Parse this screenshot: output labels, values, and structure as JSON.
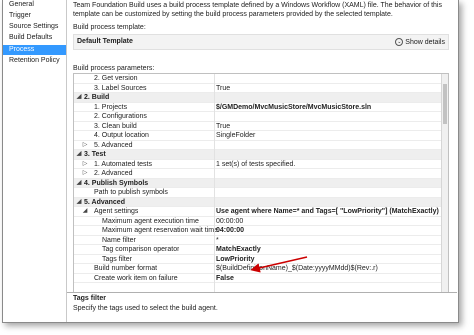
{
  "nav": {
    "items": [
      {
        "label": "General"
      },
      {
        "label": "Trigger"
      },
      {
        "label": "Source Settings"
      },
      {
        "label": "Build Defaults"
      },
      {
        "label": "Process"
      },
      {
        "label": "Retention Policy"
      }
    ],
    "selected_index": 4
  },
  "description": "Team Foundation Build uses a build process template defined by a Windows Workflow (XAML) file. The behavior of this template can be customized by setting the build process parameters provided by the selected template.",
  "template": {
    "label": "Build process template:",
    "name": "Default Template",
    "show_details": "Show details"
  },
  "params_label": "Build process parameters:",
  "rows": [
    {
      "name": "2. Get version",
      "value": "",
      "indent": 1,
      "header": false,
      "expander": "",
      "bold_value": false
    },
    {
      "name": "3. Label Sources",
      "value": "True",
      "indent": 1,
      "header": false,
      "expander": "",
      "bold_value": false
    },
    {
      "name": "2. Build",
      "value": "",
      "indent": 0,
      "header": true,
      "expander": "◢",
      "bold_value": false
    },
    {
      "name": "1. Projects",
      "value": "$/GMDemo/MvcMusicStore/MvcMusicStore.sln",
      "indent": 1,
      "header": false,
      "expander": "",
      "bold_value": true
    },
    {
      "name": "2. Configurations",
      "value": "",
      "indent": 1,
      "header": false,
      "expander": "",
      "bold_value": false
    },
    {
      "name": "3. Clean build",
      "value": "True",
      "indent": 1,
      "header": false,
      "expander": "",
      "bold_value": false
    },
    {
      "name": "4. Output location",
      "value": "SingleFolder",
      "indent": 1,
      "header": false,
      "expander": "",
      "bold_value": false
    },
    {
      "name": "5. Advanced",
      "value": "",
      "indent": 1,
      "header": false,
      "expander": "▷",
      "bold_value": false
    },
    {
      "name": "3. Test",
      "value": "",
      "indent": 0,
      "header": true,
      "expander": "◢",
      "bold_value": false
    },
    {
      "name": "1. Automated tests",
      "value": "1 set(s) of tests specified.",
      "indent": 1,
      "header": false,
      "expander": "▷",
      "bold_value": false
    },
    {
      "name": "2. Advanced",
      "value": "",
      "indent": 1,
      "header": false,
      "expander": "▷",
      "bold_value": false
    },
    {
      "name": "4. Publish Symbols",
      "value": "",
      "indent": 0,
      "header": true,
      "expander": "◢",
      "bold_value": false
    },
    {
      "name": "Path to publish symbols",
      "value": "",
      "indent": 1,
      "header": false,
      "expander": "",
      "bold_value": false
    },
    {
      "name": "5. Advanced",
      "value": "",
      "indent": 0,
      "header": true,
      "expander": "◢",
      "bold_value": false
    },
    {
      "name": "Agent settings",
      "value": "Use agent where Name=* and Tags=[ \"LowPriority\"] (MatchExactly)",
      "indent": 1,
      "header": false,
      "expander": "◢",
      "bold_value": true
    },
    {
      "name": "Maximum agent execution time",
      "value": "00:00:00",
      "indent": 2,
      "header": false,
      "expander": "",
      "bold_value": false
    },
    {
      "name": "Maximum agent reservation wait time",
      "value": "04:00:00",
      "indent": 2,
      "header": false,
      "expander": "",
      "bold_value": true
    },
    {
      "name": "Name filter",
      "value": "*",
      "indent": 2,
      "header": false,
      "expander": "",
      "bold_value": false
    },
    {
      "name": "Tag comparison operator",
      "value": "MatchExactly",
      "indent": 2,
      "header": false,
      "expander": "",
      "bold_value": true
    },
    {
      "name": "Tags filter",
      "value": "LowPriority",
      "indent": 2,
      "header": false,
      "expander": "",
      "bold_value": true
    },
    {
      "name": "Build number format",
      "value": "$(BuildDefinitionName)_$(Date:yyyyMMdd)$(Rev:.r)",
      "indent": 1,
      "header": false,
      "expander": "",
      "bold_value": false
    },
    {
      "name": "Create work item on failure",
      "value": "False",
      "indent": 1,
      "header": false,
      "expander": "",
      "bold_value": true
    }
  ],
  "help": {
    "title": "Tags filter",
    "text": "Specify the tags used to select the build agent."
  },
  "colors": {
    "selection": "#3399ff",
    "annotation_arrow": "#cc0000"
  }
}
